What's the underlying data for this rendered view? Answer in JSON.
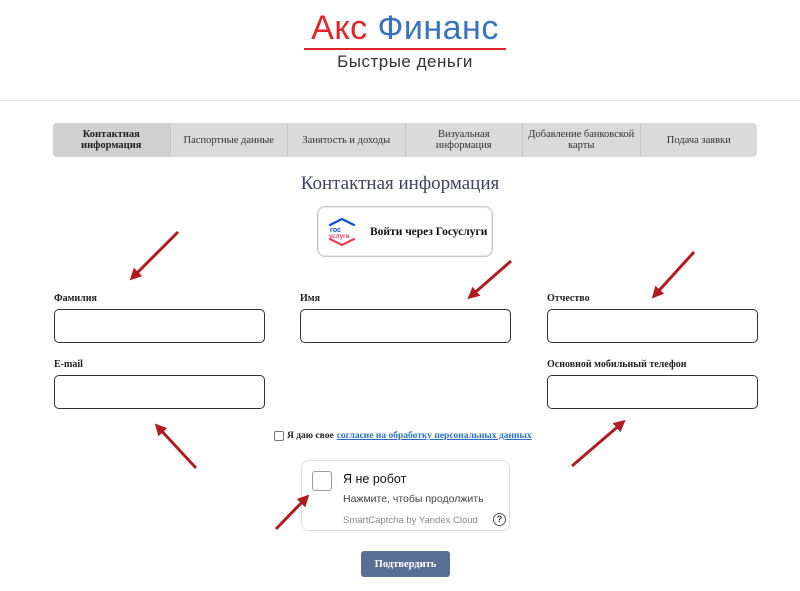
{
  "logo": {
    "part1": "Акс",
    "part2": "Финанс",
    "tagline": "Быстрые деньги"
  },
  "steps": [
    {
      "label": "Контактная информация",
      "active": true
    },
    {
      "label": "Паспортные данные",
      "active": false
    },
    {
      "label": "Занятость и доходы",
      "active": false
    },
    {
      "label": "Визуальная информация",
      "active": false
    },
    {
      "label": "Добавление банковской карты",
      "active": false
    },
    {
      "label": "Подача заявки",
      "active": false
    }
  ],
  "page_heading": "Контактная информация",
  "gosuslugi": {
    "icon_text_top": "гос",
    "icon_text_bottom": "услуги",
    "label": "Войти через Госуслуги"
  },
  "fields": {
    "last_name": {
      "label": "Фамилия",
      "value": ""
    },
    "first_name": {
      "label": "Имя",
      "value": ""
    },
    "middle_name": {
      "label": "Отчество",
      "value": ""
    },
    "email": {
      "label": "E-mail",
      "value": ""
    },
    "phone": {
      "label": "Основной мобильный телефон",
      "value": ""
    }
  },
  "consent": {
    "text": "Я даю свое",
    "link": "согласие на обработку персональных данных",
    "checked": false
  },
  "captcha": {
    "title": "Я не робот",
    "subtitle": "Нажмите, чтобы продолжить",
    "brand": "SmartCaptcha by Yandex Cloud",
    "help": "?"
  },
  "submit_label": "Подтвердить",
  "colors": {
    "brand_red": "#e0262b",
    "brand_blue": "#3b72bf",
    "button": "#5a6f95",
    "arrow": "#b01c22",
    "link": "#2b6ec4"
  }
}
